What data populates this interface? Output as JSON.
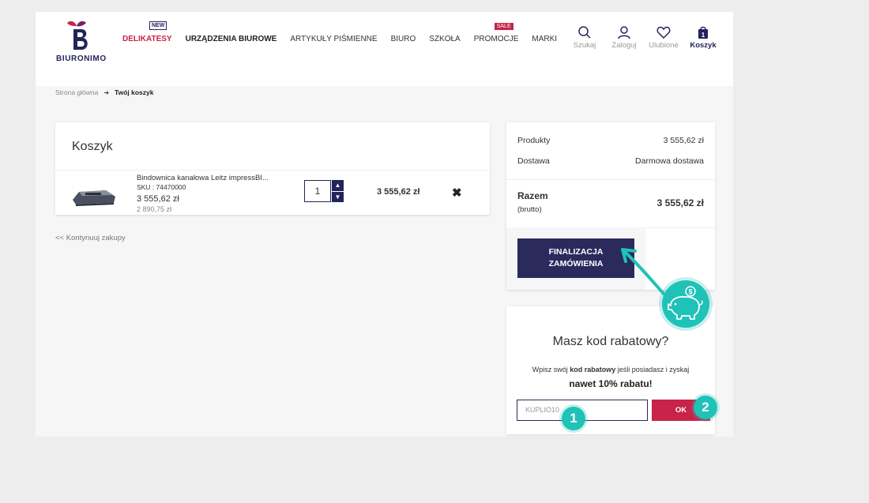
{
  "brand": {
    "logo_text": "BIURONIMO"
  },
  "nav": {
    "items": [
      {
        "label": "DELIKATESY",
        "style": "red",
        "badge": "NEW"
      },
      {
        "label": "URZĄDZENIA BIUROWE",
        "style": "bold"
      },
      {
        "label": "ARTYKUŁY PIŚMIENNE",
        "style": "normal"
      },
      {
        "label": "BIURO",
        "style": "normal"
      },
      {
        "label": "SZKOŁA",
        "style": "normal"
      },
      {
        "label": "PROMOCJE",
        "style": "normal",
        "badge": "SALE"
      },
      {
        "label": "MARKI",
        "style": "normal"
      }
    ]
  },
  "header_icons": {
    "search": "Szukaj",
    "login": "Zaloguj",
    "favorites": "Ulubione",
    "cart": "Koszyk",
    "cart_count": "1"
  },
  "breadcrumb": {
    "home": "Strona główna",
    "current": "Twój koszyk"
  },
  "cart": {
    "title": "Koszyk",
    "item": {
      "name": "Bindownica kanałowa Leitz impressBI...",
      "sku": "SKU : 74470000",
      "price": "3 555,62 zł",
      "old_price": "2 890,75 zł",
      "quantity": "1",
      "line_total": "3 555,62 zł"
    },
    "continue": "<< Kontynuuj zakupy"
  },
  "summary": {
    "products_label": "Produkty",
    "products_value": "3 555,62 zł",
    "delivery_label": "Dostawa",
    "delivery_value": "Darmowa dostawa",
    "total_label": "Razem",
    "total_sub": "(brutto)",
    "total_value": "3 555,62 zł",
    "checkout_line1": "FINALIZACJA",
    "checkout_line2": "ZAMÓWIENIA"
  },
  "discount": {
    "title": "Masz kod rabatowy?",
    "text_pre": "Wpisz swój ",
    "text_bold": "kod rabatowy",
    "text_post": " jeśli posiadasz i zyskaj",
    "highlight": "nawet 10% rabatu!",
    "input_placeholder": "KUPLIO10",
    "ok_label": "OK"
  },
  "steps": {
    "one": "1",
    "two": "2"
  },
  "colors": {
    "accent": "#24235b",
    "sale": "#c8234a",
    "teal": "#1fc2b7"
  }
}
